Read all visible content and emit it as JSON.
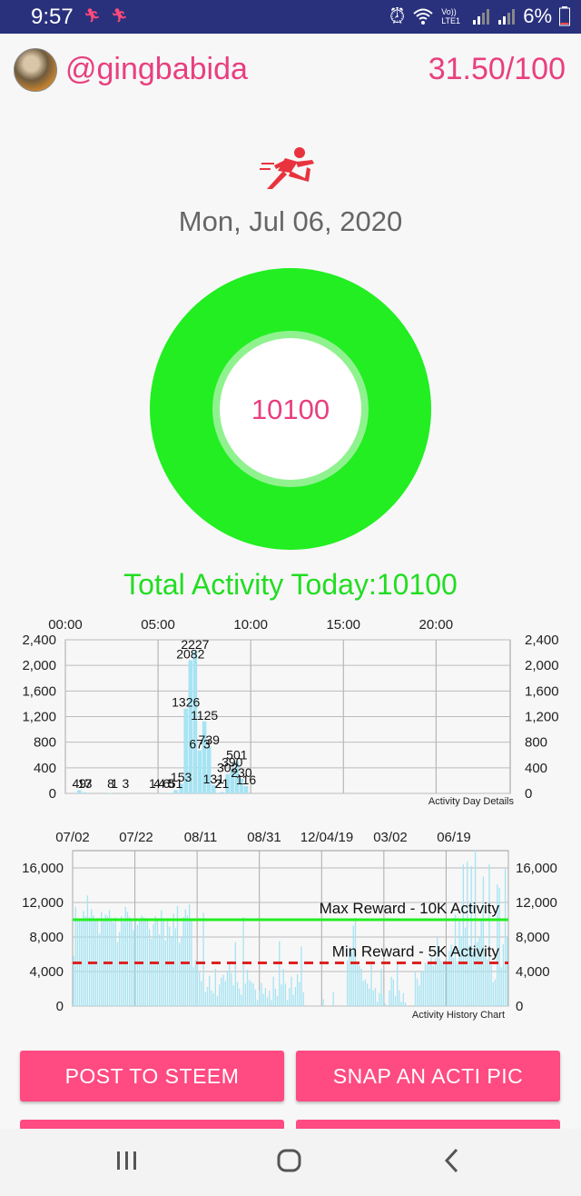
{
  "status": {
    "time": "9:57",
    "battery": "6%",
    "icons": [
      "runner-icon",
      "runner-icon",
      "alarm-icon",
      "wifi-icon",
      "signal-icon",
      "battery-icon"
    ],
    "volte": "Vo)) LTE1"
  },
  "header": {
    "username": "@gingbabida",
    "score": "31.50/100"
  },
  "date": "Mon, Jul 06, 2020",
  "ring": {
    "value": "10100",
    "ring_color": "#22ee22"
  },
  "total": "Total Activity Today:10100",
  "day_chart": {
    "type": "bar",
    "title": "",
    "caption": "Activity Day Details",
    "x_ticks": [
      "00:00",
      "05:00",
      "10:00",
      "15:00",
      "20:00"
    ],
    "y_ticks": [
      "2,400",
      "2,000",
      "1,600",
      "1,200",
      "800",
      "400",
      "0"
    ],
    "y_max": 2400,
    "hours_range": [
      0,
      24
    ],
    "bar_color": "#a6e4f3",
    "bars": [
      {
        "hour": 0.75,
        "value": 49
      },
      {
        "hour": 1.05,
        "value": 17
      },
      {
        "hour": 1.25,
        "value": 3
      },
      {
        "hour": 2.45,
        "value": 8
      },
      {
        "hour": 2.65,
        "value": 1
      },
      {
        "hour": 3.25,
        "value": 3
      },
      {
        "hour": 4.7,
        "value": 1
      },
      {
        "hour": 4.95,
        "value": 4
      },
      {
        "hour": 5.2,
        "value": 4
      },
      {
        "hour": 5.45,
        "value": 6
      },
      {
        "hour": 5.7,
        "value": 5
      },
      {
        "hour": 5.95,
        "value": 51
      },
      {
        "hour": 6.25,
        "value": 153
      },
      {
        "hour": 6.5,
        "value": 1326
      },
      {
        "hour": 6.75,
        "value": 2082
      },
      {
        "hour": 7.0,
        "value": 2227
      },
      {
        "hour": 7.25,
        "value": 673
      },
      {
        "hour": 7.5,
        "value": 1125
      },
      {
        "hour": 7.75,
        "value": 739
      },
      {
        "hour": 8.0,
        "value": 131
      },
      {
        "hour": 8.25,
        "value": 2
      },
      {
        "hour": 8.45,
        "value": 21
      },
      {
        "hour": 8.75,
        "value": 302
      },
      {
        "hour": 9.0,
        "value": 390
      },
      {
        "hour": 9.25,
        "value": 501
      },
      {
        "hour": 9.5,
        "value": 230
      },
      {
        "hour": 9.75,
        "value": 116
      }
    ]
  },
  "history_chart": {
    "type": "bar",
    "title": "",
    "caption": "Activity History Chart",
    "x_ticks": [
      "07/02",
      "07/22",
      "08/11",
      "08/31",
      "12/04/19",
      "03/02",
      "06/19"
    ],
    "y_ticks": [
      "16,000",
      "12,000",
      "8,000",
      "4,000",
      "0"
    ],
    "y_max": 18000,
    "bar_color": "#a6e4f3",
    "max_line": {
      "value": 10000,
      "label": "Max Reward - 10K Activity",
      "color": "#22ee22"
    },
    "min_line": {
      "value": 5000,
      "label": "Min Reward - 5K Activity",
      "color": "#dd2222"
    },
    "values": [
      5800,
      11500,
      10200,
      10100,
      9800,
      11000,
      10400,
      12800,
      10300,
      11200,
      10500,
      9900,
      10200,
      8400,
      10900,
      10100,
      10600,
      10400,
      11100,
      10200,
      9700,
      10300,
      7400,
      8600,
      10400,
      9800,
      11500,
      10900,
      10300,
      10000,
      8800,
      10200,
      9400,
      10100,
      10500,
      10300,
      10200,
      10100,
      8900,
      7800,
      9500,
      10400,
      10100,
      8300,
      11100,
      10000,
      7600,
      10200,
      9200,
      8100,
      10700,
      9000,
      11600,
      7300,
      8000,
      10300,
      11200,
      10500,
      11800,
      10100,
      4500,
      5300,
      4800,
      3900,
      2900,
      10800,
      1600,
      2200,
      3500,
      1800,
      1500,
      4300,
      1200,
      2500,
      3300,
      3600,
      2900,
      4100,
      5100,
      3800,
      2400,
      7400,
      2800,
      2000,
      1300,
      10300,
      2600,
      4200,
      3000,
      2800,
      2600,
      1900,
      700,
      1800,
      2700,
      1400,
      2100,
      1000,
      1800,
      700,
      3400,
      2000,
      1200,
      7500,
      2500,
      4300,
      2600,
      700,
      2100,
      3400,
      1300,
      2200,
      3700,
      2800,
      6900,
      1600,
      0,
      0,
      0,
      0,
      0,
      0,
      0,
      0,
      0,
      800,
      0,
      0,
      0,
      0,
      1600,
      0,
      0,
      0,
      0,
      0,
      0,
      5300,
      6800,
      6300,
      9300,
      10200,
      4900,
      4700,
      4300,
      2900,
      3100,
      2600,
      2000,
      5000,
      1800,
      2100,
      500,
      1500,
      4300,
      1400,
      300,
      0,
      1800,
      3400,
      3100,
      1200,
      5100,
      1800,
      500,
      1500,
      400,
      0,
      0,
      0,
      0,
      4000,
      3200,
      2400,
      4100,
      4000,
      5000,
      4900,
      5000,
      5600,
      4700,
      5500,
      7900,
      5500,
      5200,
      5000,
      5300,
      5000,
      6400,
      7100,
      5600,
      10600,
      5200,
      10000,
      8100,
      16400,
      9100,
      16700,
      7000,
      16200,
      6300,
      18100,
      7400,
      8000,
      10100,
      15000,
      6100,
      5400,
      16400,
      4800,
      2800,
      3100,
      14100,
      13700,
      4500,
      7200,
      16000,
      8000
    ]
  },
  "buttons": {
    "post": "POST TO STEEM",
    "snap": "SNAP AN ACTI PIC"
  }
}
